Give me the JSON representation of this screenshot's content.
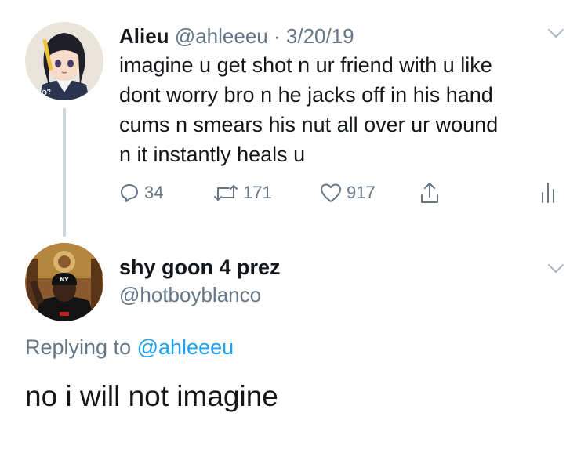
{
  "tweet": {
    "author_name": "Alieu",
    "author_handle": "@ahleeeu",
    "separator": "·",
    "date": "3/20/19",
    "text_lines": [
      "imagine u get shot n ur friend with u like",
      "dont worry bro n he jacks off in his hand",
      "cums n smears his nut all over ur wound",
      "n it instantly heals u"
    ],
    "avatar_badge": "WHO?",
    "reply_count": "34",
    "retweet_count": "171",
    "like_count": "917"
  },
  "reply": {
    "author_name": "shy goon 4 prez",
    "author_handle": "@hotboyblanco",
    "replying_prefix": "Replying to",
    "replying_to": "@ahleeeu",
    "text": "no i will not imagine"
  },
  "colors": {
    "text": "#14171a",
    "muted": "#657786",
    "link": "#1da1f2",
    "thread_line": "#ccd6dd"
  },
  "icons": {
    "reply": "reply-icon",
    "retweet": "retweet-icon",
    "like": "heart-icon",
    "share": "share-icon",
    "analytics": "analytics-icon",
    "menu": "chevron-down-icon"
  }
}
